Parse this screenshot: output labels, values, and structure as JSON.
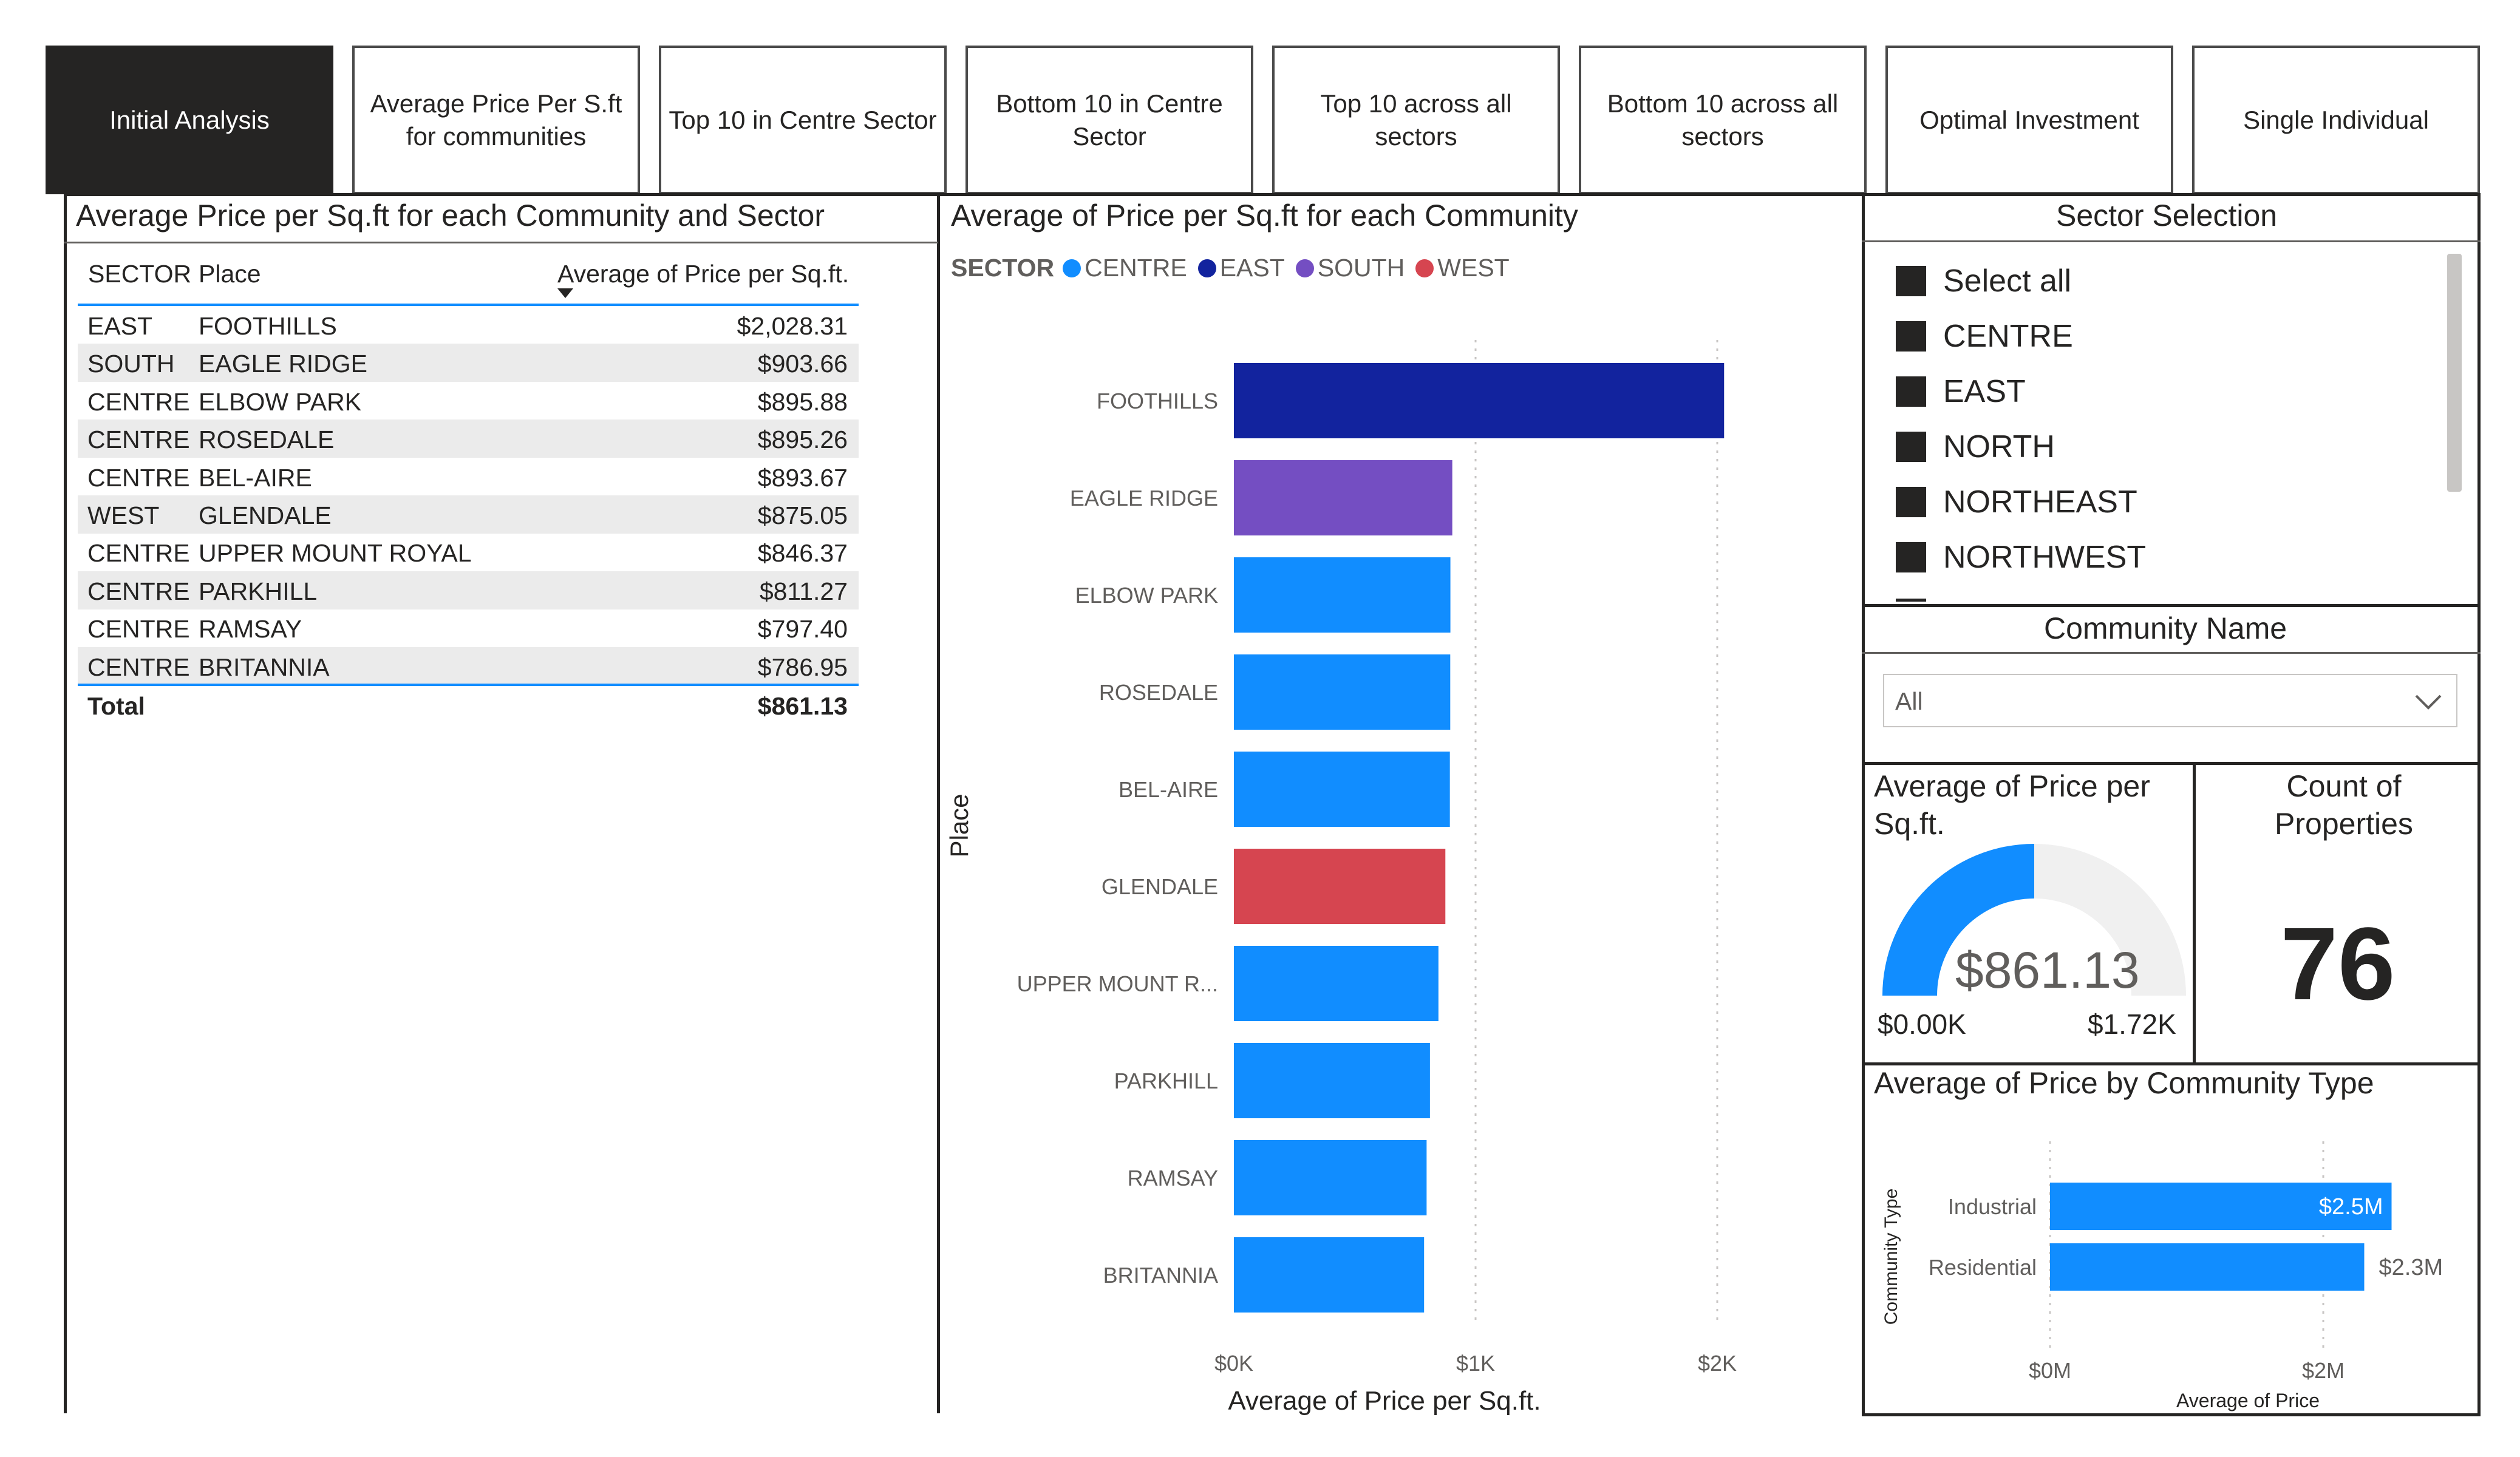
{
  "nav": {
    "tabs": [
      {
        "label": "Initial Analysis",
        "active": true
      },
      {
        "label": "Average Price Per S.ft for communities",
        "active": false
      },
      {
        "label": "Top 10 in Centre Sector",
        "active": false
      },
      {
        "label": "Bottom 10 in Centre Sector",
        "active": false
      },
      {
        "label": "Top 10 across all sectors",
        "active": false
      },
      {
        "label": "Bottom 10 across all sectors",
        "active": false
      },
      {
        "label": "Optimal Investment",
        "active": false
      },
      {
        "label": "Single Individual",
        "active": false
      }
    ]
  },
  "table": {
    "title": "Average Price per Sq.ft for each Community and Sector",
    "columns": [
      "SECTOR",
      "Place",
      "Average of Price per Sq.ft."
    ],
    "rows": [
      {
        "sector": "EAST",
        "place": "FOOTHILLS",
        "value": "$2,028.31"
      },
      {
        "sector": "SOUTH",
        "place": "EAGLE RIDGE",
        "value": "$903.66"
      },
      {
        "sector": "CENTRE",
        "place": "ELBOW PARK",
        "value": "$895.88"
      },
      {
        "sector": "CENTRE",
        "place": "ROSEDALE",
        "value": "$895.26"
      },
      {
        "sector": "CENTRE",
        "place": "BEL-AIRE",
        "value": "$893.67"
      },
      {
        "sector": "WEST",
        "place": "GLENDALE",
        "value": "$875.05"
      },
      {
        "sector": "CENTRE",
        "place": "UPPER MOUNT ROYAL",
        "value": "$846.37"
      },
      {
        "sector": "CENTRE",
        "place": "PARKHILL",
        "value": "$811.27"
      },
      {
        "sector": "CENTRE",
        "place": "RAMSAY",
        "value": "$797.40"
      },
      {
        "sector": "CENTRE",
        "place": "BRITANNIA",
        "value": "$786.95"
      }
    ],
    "total_label": "Total",
    "total_value": "$861.13"
  },
  "bar_panel": {
    "title": "Average of Price per Sq.ft for each Community",
    "legend_title": "SECTOR",
    "legend": [
      {
        "name": "CENTRE",
        "color": "#118dff"
      },
      {
        "name": "EAST",
        "color": "#12239e"
      },
      {
        "name": "SOUTH",
        "color": "#744ec2"
      },
      {
        "name": "WEST",
        "color": "#d64550"
      }
    ]
  },
  "sector_slicer": {
    "title": "Sector Selection",
    "items": [
      "Select all",
      "CENTRE",
      "EAST",
      "NORTH",
      "NORTHEAST",
      "NORTHWEST"
    ]
  },
  "community_slicer": {
    "title": "Community Name",
    "selected": "All"
  },
  "gauge": {
    "title": "Average of Price per Sq.ft.",
    "value_label": "$861.13",
    "min_label": "$0.00K",
    "max_label": "$1.72K",
    "fraction": 0.5
  },
  "card": {
    "title": "Count of Properties",
    "value": "76"
  },
  "community_type": {
    "title": "Average of Price by Community Type"
  },
  "chart_data": [
    {
      "type": "bar",
      "title": "Average of Price per Sq.ft for each Community",
      "orientation": "horizontal",
      "ylabel": "Place",
      "xlabel": "Average of Price per Sq.ft.",
      "categories": [
        "FOOTHILLS",
        "EAGLE RIDGE",
        "ELBOW PARK",
        "ROSEDALE",
        "BEL-AIRE",
        "GLENDALE",
        "UPPER MOUNT R...",
        "PARKHILL",
        "RAMSAY",
        "BRITANNIA"
      ],
      "values": [
        2028.31,
        903.66,
        895.88,
        895.26,
        893.67,
        875.05,
        846.37,
        811.27,
        797.4,
        786.95
      ],
      "sectors": [
        "EAST",
        "SOUTH",
        "CENTRE",
        "CENTRE",
        "CENTRE",
        "WEST",
        "CENTRE",
        "CENTRE",
        "CENTRE",
        "CENTRE"
      ],
      "colors": [
        "#12239e",
        "#744ec2",
        "#118dff",
        "#118dff",
        "#118dff",
        "#d64550",
        "#118dff",
        "#118dff",
        "#118dff",
        "#118dff"
      ],
      "xlim": [
        0,
        2000
      ],
      "xticks": [
        "$0K",
        "$1K",
        "$2K"
      ],
      "xtick_values": [
        0,
        1000,
        2000
      ],
      "grid": true,
      "legend": "top-left"
    },
    {
      "type": "bar",
      "title": "Average of Price by Community Type",
      "orientation": "horizontal",
      "ylabel": "Community Type",
      "xlabel": "Average of Price",
      "categories": [
        "Industrial",
        "Residential"
      ],
      "values": [
        2500000,
        2300000
      ],
      "data_labels": [
        "$2.5M",
        "$2.3M"
      ],
      "colors": [
        "#118dff",
        "#118dff"
      ],
      "xlim": [
        0,
        2000000
      ],
      "xticks": [
        "$0M",
        "$2M"
      ],
      "xtick_values": [
        0,
        2000000
      ],
      "grid": true
    }
  ]
}
